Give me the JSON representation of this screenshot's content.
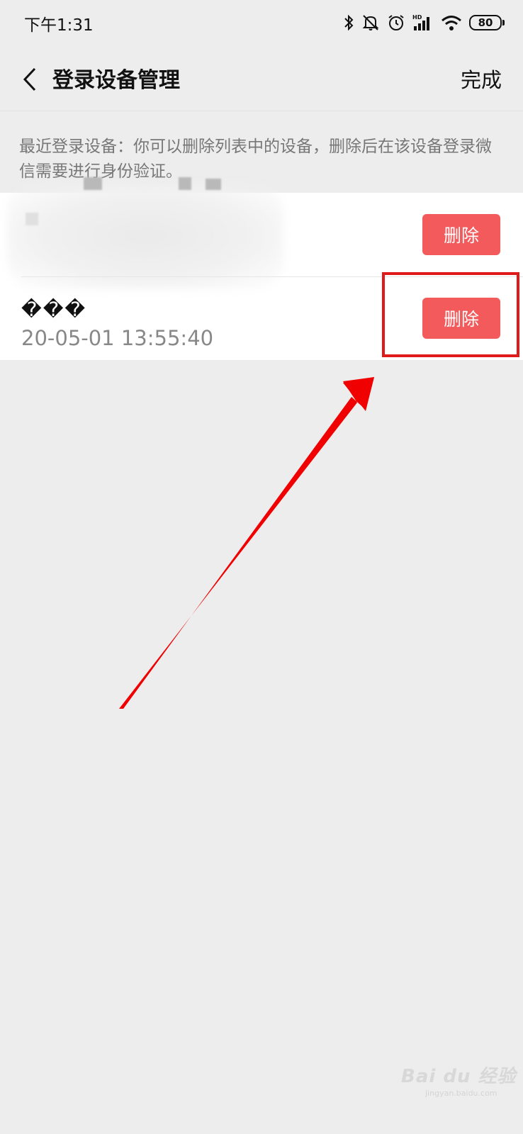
{
  "status_bar": {
    "time": "下午1:31",
    "icons": [
      "bluetooth-icon",
      "mute-icon",
      "alarm-icon",
      "signal-hd-icon",
      "wifi-icon"
    ],
    "battery": "80"
  },
  "nav": {
    "title": "登录设备管理",
    "done_label": "完成"
  },
  "description": "最近登录设备：你可以删除列表中的设备，删除后在该设备登录微信需要进行身份验证。",
  "devices": [
    {
      "name": "",
      "time": "",
      "delete_label": "删除",
      "obscured": true
    },
    {
      "name": "���",
      "time": "20-05-01 13:55:40",
      "delete_label": "删除",
      "obscured": false
    }
  ],
  "annotations": {
    "highlight_color": "#e01a1a",
    "arrow_color": "#f00000"
  },
  "watermark": {
    "text": "Bai du 经验",
    "sub": "jingyan.baidu.com"
  },
  "colors": {
    "background": "#ededed",
    "delete_button": "#f35a5c"
  }
}
